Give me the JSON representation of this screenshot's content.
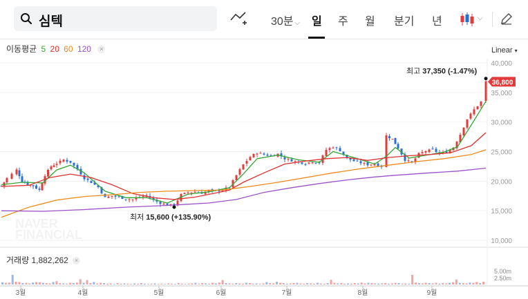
{
  "search": {
    "value": "심텍"
  },
  "toolbar": {
    "interval": "30분",
    "tabs": [
      "일",
      "주",
      "월",
      "분기",
      "년"
    ],
    "active_tab": "일",
    "icons": [
      "draw-trend-icon",
      "candle-type-icon",
      "pencil-icon"
    ]
  },
  "legend": {
    "ma_label": "이동평균",
    "ma_periods": [
      {
        "label": "5",
        "color": "#33a533"
      },
      {
        "label": "20",
        "color": "#e03030"
      },
      {
        "label": "60",
        "color": "#f08a1a"
      },
      {
        "label": "120",
        "color": "#9b52c9"
      }
    ],
    "close_x": "×",
    "volume_label": "거래량 1,882,262"
  },
  "scale_label": "Linear",
  "watermark": [
    "NAVER",
    "FINANCIAL"
  ],
  "annotations": {
    "high": {
      "prefix": "최고",
      "value": "37,350 (-1.47%)"
    },
    "low": {
      "prefix": "최저",
      "value": "15,600 (+135.90%)"
    },
    "current": "36,800"
  },
  "colors": {
    "up": "#e23b3b",
    "down": "#2a6fd6",
    "current_tag": "#e23b3b"
  },
  "chart_data": {
    "type": "candlestick",
    "y_ticks": [
      "40,000",
      "35,000",
      "30,000",
      "25,000",
      "20,000",
      "15,000",
      "10,000"
    ],
    "ylim": [
      10000,
      40000
    ],
    "x_ticks": [
      "3월",
      "4월",
      "5월",
      "6월",
      "7월",
      "8월",
      "9월"
    ],
    "volume_ticks": [
      "5.00m",
      "2.50m"
    ],
    "price_points": [
      [
        0,
        19200
      ],
      [
        8,
        20500
      ],
      [
        15,
        21200
      ],
      [
        22,
        21900
      ],
      [
        30,
        20000
      ],
      [
        38,
        19500
      ],
      [
        46,
        19200
      ],
      [
        55,
        18500
      ],
      [
        63,
        21000
      ],
      [
        72,
        22500
      ],
      [
        80,
        23000
      ],
      [
        90,
        23600
      ],
      [
        100,
        23200
      ],
      [
        110,
        22000
      ],
      [
        120,
        20500
      ],
      [
        130,
        19800
      ],
      [
        140,
        19000
      ],
      [
        150,
        17200
      ],
      [
        160,
        17500
      ],
      [
        170,
        17300
      ],
      [
        180,
        17000
      ],
      [
        190,
        16900
      ],
      [
        200,
        17300
      ],
      [
        210,
        17600
      ],
      [
        220,
        16800
      ],
      [
        230,
        16300
      ],
      [
        240,
        16000
      ],
      [
        250,
        15900
      ],
      [
        260,
        17700
      ],
      [
        270,
        18100
      ],
      [
        280,
        18200
      ],
      [
        290,
        18000
      ],
      [
        300,
        18400
      ],
      [
        310,
        18300
      ],
      [
        320,
        18500
      ],
      [
        330,
        19000
      ],
      [
        340,
        21000
      ],
      [
        350,
        22800
      ],
      [
        360,
        24100
      ],
      [
        370,
        24800
      ],
      [
        380,
        24500
      ],
      [
        390,
        24300
      ],
      [
        400,
        24600
      ],
      [
        410,
        23800
      ],
      [
        420,
        23500
      ],
      [
        430,
        23200
      ],
      [
        440,
        23000
      ],
      [
        450,
        23300
      ],
      [
        460,
        23100
      ],
      [
        470,
        25300
      ],
      [
        480,
        25800
      ],
      [
        490,
        25200
      ],
      [
        500,
        23900
      ],
      [
        510,
        23400
      ],
      [
        520,
        23100
      ],
      [
        530,
        22800
      ],
      [
        540,
        22900
      ],
      [
        550,
        22500
      ],
      [
        557,
        27700
      ],
      [
        566,
        27100
      ],
      [
        574,
        25600
      ],
      [
        584,
        23600
      ],
      [
        594,
        23100
      ],
      [
        604,
        24600
      ],
      [
        614,
        25100
      ],
      [
        624,
        25300
      ],
      [
        634,
        24700
      ],
      [
        644,
        24900
      ],
      [
        654,
        25700
      ],
      [
        664,
        27900
      ],
      [
        674,
        30500
      ],
      [
        684,
        32100
      ],
      [
        694,
        33400
      ],
      [
        701,
        36800
      ]
    ],
    "ma_series": [
      {
        "name": "5",
        "points": [
          [
            0,
            19400
          ],
          [
            30,
            19800
          ],
          [
            60,
            19700
          ],
          [
            80,
            21900
          ],
          [
            100,
            22700
          ],
          [
            120,
            21400
          ],
          [
            150,
            18300
          ],
          [
            180,
            17200
          ],
          [
            210,
            17200
          ],
          [
            240,
            16300
          ],
          [
            270,
            17800
          ],
          [
            300,
            18200
          ],
          [
            330,
            18900
          ],
          [
            350,
            21200
          ],
          [
            370,
            23800
          ],
          [
            400,
            24400
          ],
          [
            430,
            23600
          ],
          [
            460,
            23200
          ],
          [
            480,
            25000
          ],
          [
            510,
            24000
          ],
          [
            540,
            22900
          ],
          [
            557,
            24200
          ],
          [
            570,
            25700
          ],
          [
            590,
            23900
          ],
          [
            610,
            24300
          ],
          [
            640,
            24900
          ],
          [
            660,
            25800
          ],
          [
            680,
            29500
          ],
          [
            701,
            33500
          ]
        ]
      },
      {
        "name": "20",
        "points": [
          [
            0,
            19100
          ],
          [
            40,
            19300
          ],
          [
            70,
            20600
          ],
          [
            100,
            21200
          ],
          [
            130,
            20600
          ],
          [
            160,
            19400
          ],
          [
            190,
            17900
          ],
          [
            220,
            17200
          ],
          [
            250,
            16900
          ],
          [
            280,
            17300
          ],
          [
            310,
            18000
          ],
          [
            330,
            18500
          ],
          [
            350,
            19800
          ],
          [
            380,
            21400
          ],
          [
            410,
            22900
          ],
          [
            440,
            23400
          ],
          [
            470,
            23800
          ],
          [
            500,
            24000
          ],
          [
            530,
            23500
          ],
          [
            560,
            24000
          ],
          [
            590,
            24300
          ],
          [
            620,
            24500
          ],
          [
            650,
            24800
          ],
          [
            680,
            26000
          ],
          [
            701,
            28200
          ]
        ]
      },
      {
        "name": "60",
        "points": [
          [
            0,
            13900
          ],
          [
            40,
            15600
          ],
          [
            80,
            16800
          ],
          [
            120,
            17400
          ],
          [
            160,
            17700
          ],
          [
            200,
            18100
          ],
          [
            240,
            18300
          ],
          [
            280,
            18400
          ],
          [
            320,
            18500
          ],
          [
            360,
            19100
          ],
          [
            400,
            19800
          ],
          [
            440,
            20600
          ],
          [
            480,
            21400
          ],
          [
            520,
            22100
          ],
          [
            560,
            22700
          ],
          [
            600,
            23300
          ],
          [
            640,
            23800
          ],
          [
            680,
            24500
          ],
          [
            701,
            25300
          ]
        ]
      },
      {
        "name": "120",
        "points": [
          [
            0,
            15000
          ],
          [
            60,
            14900
          ],
          [
            120,
            15200
          ],
          [
            180,
            15600
          ],
          [
            240,
            15900
          ],
          [
            300,
            16300
          ],
          [
            340,
            16900
          ],
          [
            380,
            18100
          ],
          [
            420,
            18900
          ],
          [
            460,
            19600
          ],
          [
            500,
            20200
          ],
          [
            540,
            20700
          ],
          [
            570,
            21000
          ],
          [
            620,
            21400
          ],
          [
            660,
            21700
          ],
          [
            701,
            22200
          ]
        ]
      }
    ],
    "volumes_m": [
      0.8,
      0.6,
      0.7,
      3.5,
      1.0,
      0.9,
      0.5,
      0.6,
      0.4,
      0.7,
      0.9,
      0.8,
      0.6,
      0.5,
      0.4,
      0.9,
      1.2,
      0.5,
      0.4,
      0.3,
      0.6,
      0.5,
      0.7,
      1.9,
      0.6,
      1.6,
      0.5,
      0.9,
      0.4,
      0.6,
      0.5,
      0.3,
      0.4,
      0.2,
      0.5,
      0.3,
      0.4,
      0.3,
      0.2,
      0.4,
      0.3,
      0.5,
      0.3,
      0.2,
      0.3,
      0.4,
      0.2,
      0.3,
      0.2,
      0.4,
      0.3,
      0.2,
      0.5,
      0.3,
      0.2,
      0.3,
      0.4,
      0.6,
      0.3,
      0.5,
      0.4,
      0.3,
      0.6,
      0.4,
      0.7,
      1.6,
      0.5,
      0.4,
      0.3,
      0.5,
      0.4,
      0.3,
      0.6,
      0.5,
      0.3,
      0.4,
      0.3,
      0.4,
      0.9,
      0.5,
      0.4,
      1.0,
      0.6,
      0.5,
      0.3,
      0.4,
      0.5,
      0.6,
      0.4,
      0.3,
      0.5,
      0.4,
      0.3,
      0.6,
      0.4,
      0.3,
      0.5,
      1.7,
      0.6,
      0.4,
      0.5,
      0.3,
      0.4,
      0.3,
      0.5,
      0.4,
      0.7,
      0.4,
      0.6,
      0.5,
      0.4,
      0.3,
      0.4,
      0.5,
      0.3,
      0.4,
      0.6,
      0.5,
      0.3,
      0.4,
      0.3,
      3.5,
      0.7,
      0.5,
      0.4,
      0.6,
      0.5,
      0.4,
      0.6,
      0.3,
      0.5,
      0.4,
      0.6,
      0.8,
      1.8,
      0.6,
      0.5,
      0.4,
      0.7,
      0.6,
      0.9,
      0.5,
      1.0
    ]
  }
}
